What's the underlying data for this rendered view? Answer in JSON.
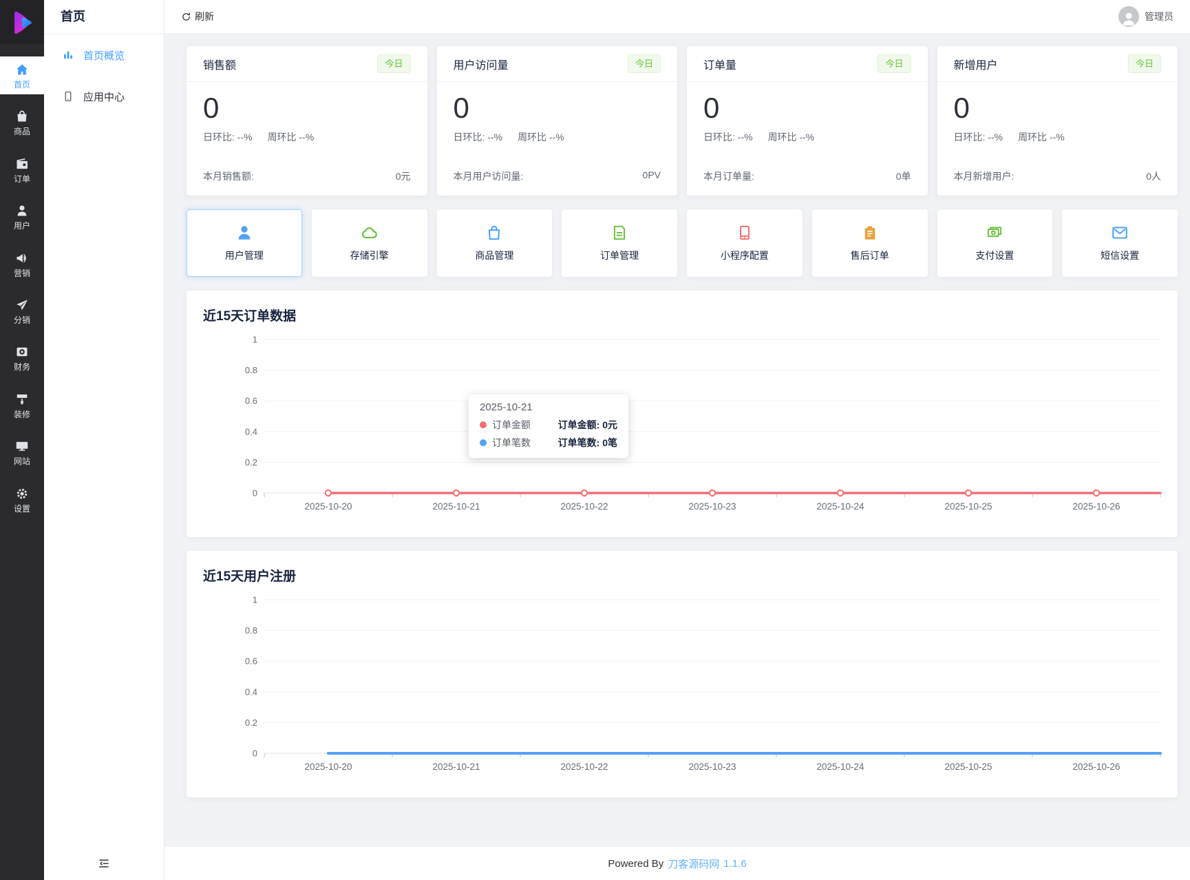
{
  "topbar": {
    "refresh_label": "刷新",
    "admin_label": "管理员"
  },
  "sidebar": {
    "items": [
      {
        "id": "home",
        "label": "首页",
        "icon": "home",
        "active": true
      },
      {
        "id": "goods",
        "label": "商品",
        "icon": "bag",
        "active": false
      },
      {
        "id": "orders",
        "label": "订单",
        "icon": "order",
        "active": false
      },
      {
        "id": "users",
        "label": "用户",
        "icon": "user",
        "active": false
      },
      {
        "id": "marketing",
        "label": "营销",
        "icon": "megaphone",
        "active": false
      },
      {
        "id": "distribution",
        "label": "分销",
        "icon": "plane",
        "active": false
      },
      {
        "id": "finance",
        "label": "财务",
        "icon": "money-frame",
        "active": false
      },
      {
        "id": "decorate",
        "label": "装修",
        "icon": "paint-roller",
        "active": false
      },
      {
        "id": "website",
        "label": "网站",
        "icon": "monitor",
        "active": false
      },
      {
        "id": "settings",
        "label": "设置",
        "icon": "gear",
        "active": false
      }
    ]
  },
  "submenu": {
    "title": "首页",
    "items": [
      {
        "id": "overview",
        "label": "首页概览",
        "icon": "bar-chart",
        "active": true
      },
      {
        "id": "app-center",
        "label": "应用中心",
        "icon": "app",
        "active": false
      }
    ]
  },
  "stats": [
    {
      "id": "sales",
      "title": "销售额",
      "badge": "今日",
      "value": "0",
      "day_ratio": "日环比: --%",
      "week_ratio": "周环比 --%",
      "footer_label": "本月销售额:",
      "footer_value": "0元"
    },
    {
      "id": "visits",
      "title": "用户访问量",
      "badge": "今日",
      "value": "0",
      "day_ratio": "日环比: --%",
      "week_ratio": "周环比 --%",
      "footer_label": "本月用户访问量:",
      "footer_value": "0PV"
    },
    {
      "id": "orders",
      "title": "订单量",
      "badge": "今日",
      "value": "0",
      "day_ratio": "日环比: --%",
      "week_ratio": "周环比 --%",
      "footer_label": "本月订单量:",
      "footer_value": "0单"
    },
    {
      "id": "new-users",
      "title": "新增用户",
      "badge": "今日",
      "value": "0",
      "day_ratio": "日环比: --%",
      "week_ratio": "周环比 --%",
      "footer_label": "本月新增用户:",
      "footer_value": "0人"
    }
  ],
  "shortcuts": [
    {
      "id": "user-manage",
      "label": "用户管理",
      "icon": "user-fill",
      "color": "#54a0f8",
      "active": true
    },
    {
      "id": "storage",
      "label": "存储引擎",
      "icon": "cloud",
      "color": "#67c23a",
      "active": false
    },
    {
      "id": "goods-manage",
      "label": "商品管理",
      "icon": "bag-outline",
      "color": "#409eff",
      "active": false
    },
    {
      "id": "order-manage",
      "label": "订单管理",
      "icon": "doc",
      "color": "#67c23a",
      "active": false
    },
    {
      "id": "mini-program",
      "label": "小程序配置",
      "icon": "phone",
      "color": "#f56c6c",
      "active": false
    },
    {
      "id": "after-sale",
      "label": "售后订单",
      "icon": "clipboard",
      "color": "#e6a23c",
      "active": false
    },
    {
      "id": "payment",
      "label": "支付设置",
      "icon": "money",
      "color": "#67c23a",
      "active": false
    },
    {
      "id": "sms",
      "label": "短信设置",
      "icon": "mail",
      "color": "#409eff",
      "active": false
    }
  ],
  "chart_data": [
    {
      "type": "line",
      "title": "近15天订单数据",
      "categories": [
        "2025-10-20",
        "2025-10-21",
        "2025-10-22",
        "2025-10-23",
        "2025-10-24",
        "2025-10-25",
        "2025-10-26"
      ],
      "series": [
        {
          "name": "订单金额",
          "values": [
            0,
            0,
            0,
            0,
            0,
            0,
            0
          ],
          "unit": "元",
          "color": "#f56c6c",
          "markers": true
        },
        {
          "name": "订单笔数",
          "values": [
            0,
            0,
            0,
            0,
            0,
            0,
            0
          ],
          "unit": "笔",
          "color": "#54a0f8",
          "markers": false
        }
      ],
      "ylim": [
        0,
        1
      ],
      "yticks": [
        0,
        0.2,
        0.4,
        0.6,
        0.8,
        1
      ],
      "grid": true,
      "legend": "none"
    },
    {
      "type": "line",
      "title": "近15天用户注册",
      "categories": [
        "2025-10-20",
        "2025-10-21",
        "2025-10-22",
        "2025-10-23",
        "2025-10-24",
        "2025-10-25",
        "2025-10-26"
      ],
      "series": [
        {
          "name": "用户注册",
          "values": [
            0,
            0,
            0,
            0,
            0,
            0,
            0
          ],
          "color": "#54a0f8",
          "markers": false
        }
      ],
      "ylim": [
        0,
        1
      ],
      "yticks": [
        0,
        0.2,
        0.4,
        0.6,
        0.8,
        1
      ],
      "grid": true,
      "legend": "none"
    }
  ],
  "tooltip": {
    "date": "2025-10-21",
    "rows": [
      {
        "name": "订单金额",
        "value": "订单金额: 0元",
        "color": "#f56c6c"
      },
      {
        "name": "订单笔数",
        "value": "订单笔数: 0笔",
        "color": "#54a0f8"
      }
    ]
  },
  "footer": {
    "prefix": "Powered By",
    "brand": "刀客源码网",
    "version": "1.1.6"
  },
  "colors": {
    "accent": "#409eff",
    "success": "#67c23a",
    "danger": "#f56c6c",
    "warning": "#e6a23c",
    "chart_red": "#f56c6c",
    "chart_blue": "#54a0f8"
  }
}
